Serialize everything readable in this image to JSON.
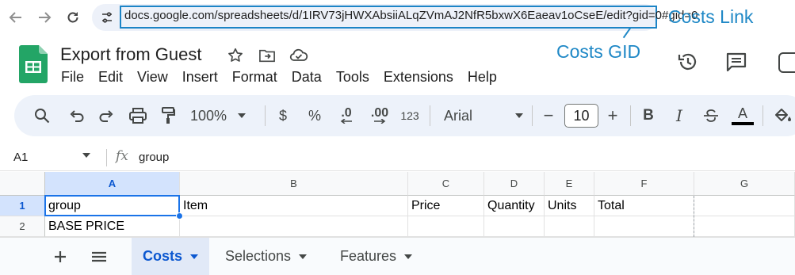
{
  "browser": {
    "url": "docs.google.com/spreadsheets/d/1IRV73jHWXAbsiiALqZVmAJ2NfR5bxwX6Eaeav1oCseE/edit?gid=0#gid=0",
    "icons": [
      "back-icon",
      "forward-icon",
      "reload-icon",
      "site-info-icon"
    ]
  },
  "annotations": {
    "costs_link": "Costs Link",
    "costs_gid": "Costs GID",
    "color": "#1f88c6"
  },
  "app": {
    "title": "Export from Guest",
    "menu": [
      "File",
      "Edit",
      "View",
      "Insert",
      "Format",
      "Data",
      "Tools",
      "Extensions",
      "Help"
    ],
    "title_icons": [
      "star-icon",
      "move-to-folder-icon",
      "cloud-status-icon"
    ],
    "header_icons": [
      "version-history-icon",
      "comments-icon"
    ]
  },
  "toolbar": {
    "zoom": "100%",
    "currency": "$",
    "percent": "%",
    "decrease_decimal": ".0",
    "increase_decimal": ".00",
    "number_format": "123",
    "font": "Arial",
    "font_size": "10",
    "minus": "−",
    "plus": "+",
    "bold": "B",
    "italic": "I",
    "text_color_letter": "A"
  },
  "formula_bar": {
    "cell_ref": "A1",
    "fx": "fx",
    "content": "group"
  },
  "grid": {
    "columns": [
      "A",
      "B",
      "C",
      "D",
      "E",
      "F",
      "G"
    ],
    "rows": [
      {
        "num": "1",
        "cells": [
          "group",
          "Item",
          "Price",
          "Quantity",
          "Units",
          "Total",
          ""
        ]
      },
      {
        "num": "2",
        "cells": [
          "BASE PRICE",
          "",
          "",
          "",
          "",
          "",
          ""
        ]
      }
    ],
    "selected_cell": "A1",
    "accent": "#1a73e8"
  },
  "sheets": {
    "tabs": [
      "Costs",
      "Selections",
      "Features"
    ],
    "active": "Costs"
  }
}
